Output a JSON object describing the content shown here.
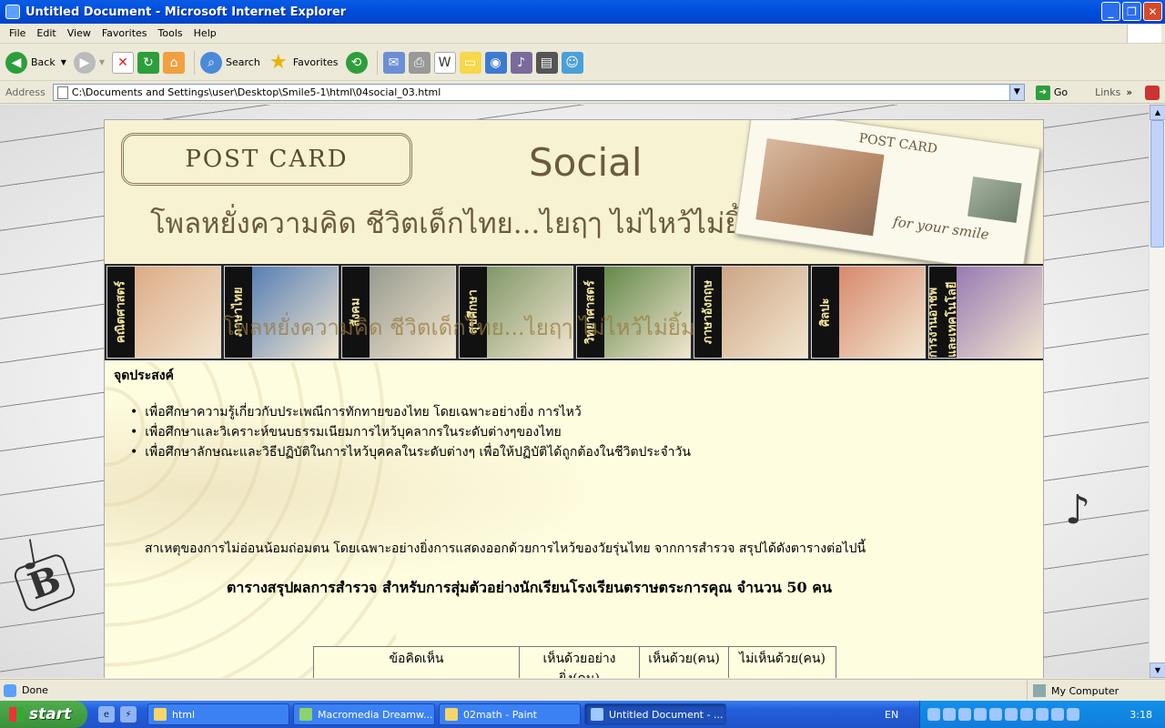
{
  "window": {
    "title": "Untitled Document - Microsoft Internet Explorer"
  },
  "menu": [
    "File",
    "Edit",
    "View",
    "Favorites",
    "Tools",
    "Help"
  ],
  "toolbar": {
    "back": "Back",
    "search": "Search",
    "favorites": "Favorites"
  },
  "address": {
    "label": "Address",
    "url": "C:\\Documents and Settings\\user\\Desktop\\Smile5-1\\html\\04social_03.html",
    "go": "Go",
    "links": "Links"
  },
  "banner": {
    "postcard": "POST CARD",
    "title": "Social",
    "subtitle": "โพลหยั่งความคิด  ชีวิตเด็กไทย...ไยฤๅ  ไม่ไหว้ไม่ยิ้ม",
    "card_label": "POST CARD",
    "card_note": "for your smile"
  },
  "nav_tiles": [
    {
      "label": "คณิตศาสตร์",
      "color": "#d9a37c"
    },
    {
      "label": "ภาษาไทย",
      "color": "#3f6fb0"
    },
    {
      "label": "สังคม",
      "color": "#8a8f86"
    },
    {
      "label": "สุขศึกษา",
      "color": "#6f8b5a"
    },
    {
      "label": "วิทยาศาสตร์",
      "color": "#4d7a36"
    },
    {
      "label": "ภาษาอังกฤษ",
      "color": "#c79b7a"
    },
    {
      "label": "ศิลปะ",
      "color": "#d37b5e"
    },
    {
      "label": "การงานอาชีพและเทคโนโลยี",
      "color": "#8a6ab0"
    }
  ],
  "marquee": "โพลหยั่งความคิด  ชีวิตเด็กไทย...ไยฤๅ  ไม่ไหว้ไม่ยิ้ม",
  "content": {
    "purpose_heading": "จุดประสงค์",
    "bullets": [
      "เพื่อศึกษาความรู้เกี่ยวกับประเพณีการทักทายของไทย  โดยเฉพาะอย่างยิ่ง  การไหว้",
      "เพื่อศึกษาและวิเคราะห์ขนบธรรมเนียมการไหว้บุคลากรในระดับต่างๆของไทย",
      "เพื่อศึกษาลักษณะและวิธีปฏิบัติในการไหว้บุคคลในระดับต่างๆ  เพื่อให้ปฏิบัติได้ถูกต้องในชีวิตประจำวัน"
    ],
    "paragraph": "สาเหตุของการไม่อ่อนน้อมถ่อมตน  โดยเฉพาะอย่างยิ่งการแสดงออกด้วยการไหว้ของวัยรุ่นไทย จากการสำรวจ  สรุปได้ดังตารางต่อไปนี้",
    "table_title": "ตารางสรุปผลการสำรวจ  สำหรับการสุ่มตัวอย่างนักเรียนโรงเรียนตราษตระการคุณ  จำนวน 50 คน",
    "table_headers": [
      "ข้อคิดเห็น",
      "เห็นด้วยอย่างยิ่ง(คน)",
      "เห็นด้วย(คน)",
      "ไม่เห็นด้วย(คน)"
    ]
  },
  "status": {
    "text": "Done",
    "zone": "My Computer"
  },
  "taskbar": {
    "start": "start",
    "tasks": [
      "html",
      "Macromedia Dreamw...",
      "02math - Paint",
      "Untitled Document - ..."
    ],
    "lang": "EN",
    "clock": "3:18"
  }
}
